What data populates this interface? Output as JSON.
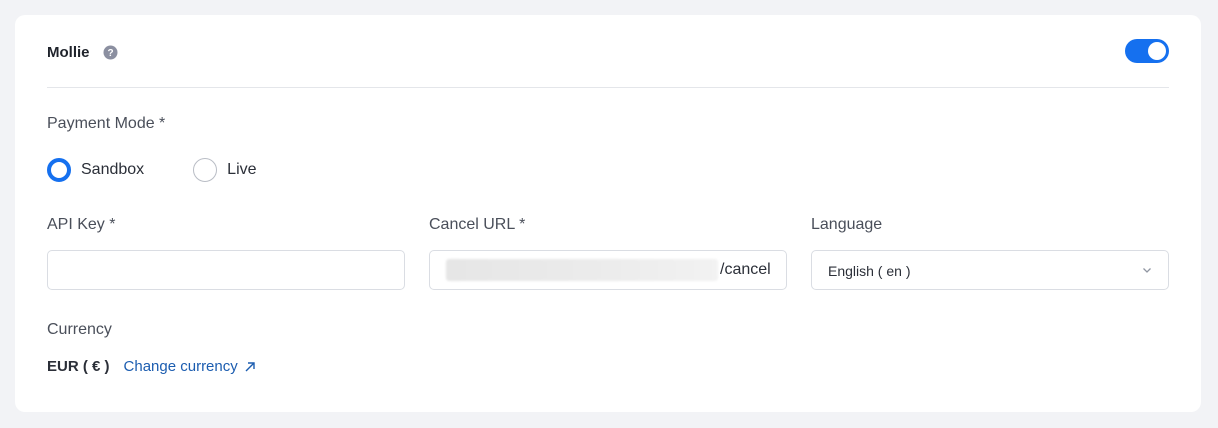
{
  "header": {
    "title": "Mollie",
    "help_icon": "help-circle-icon",
    "enabled": true
  },
  "payment_mode": {
    "label": "Payment Mode *",
    "options": [
      {
        "label": "Sandbox",
        "selected": true
      },
      {
        "label": "Live",
        "selected": false
      }
    ]
  },
  "api_key": {
    "label": "API Key *",
    "value": ""
  },
  "cancel_url": {
    "label": "Cancel URL *",
    "visible_suffix": "/cancel"
  },
  "language": {
    "label": "Language",
    "selected": "English ( en )",
    "icon": "chevron-down-icon"
  },
  "currency": {
    "label": "Currency",
    "value": "EUR ( € )",
    "change_link": "Change currency",
    "link_icon": "external-arrow-icon"
  },
  "colors": {
    "accent": "#1570ef",
    "link": "#1c5db0",
    "background": "#f2f3f6"
  }
}
